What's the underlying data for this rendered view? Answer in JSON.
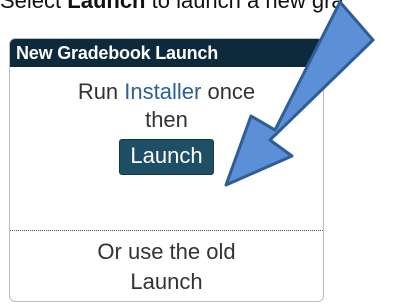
{
  "caption": {
    "prefix": "Select ",
    "bold": "Launch",
    "suffix": " to launch a new gra"
  },
  "panel": {
    "header": "New Gradebook Launch",
    "installer_prefix": "Run ",
    "installer_link": "Installer",
    "installer_suffix": " once",
    "then": "then",
    "launch_button": "Launch",
    "old_line1": "Or use the old",
    "old_line2": "Launch"
  },
  "colors": {
    "header_bg": "#0d2a3d",
    "button_bg": "#1e4f66",
    "arrow_fill": "#5b8fd6",
    "arrow_stroke": "#2f5d96"
  }
}
